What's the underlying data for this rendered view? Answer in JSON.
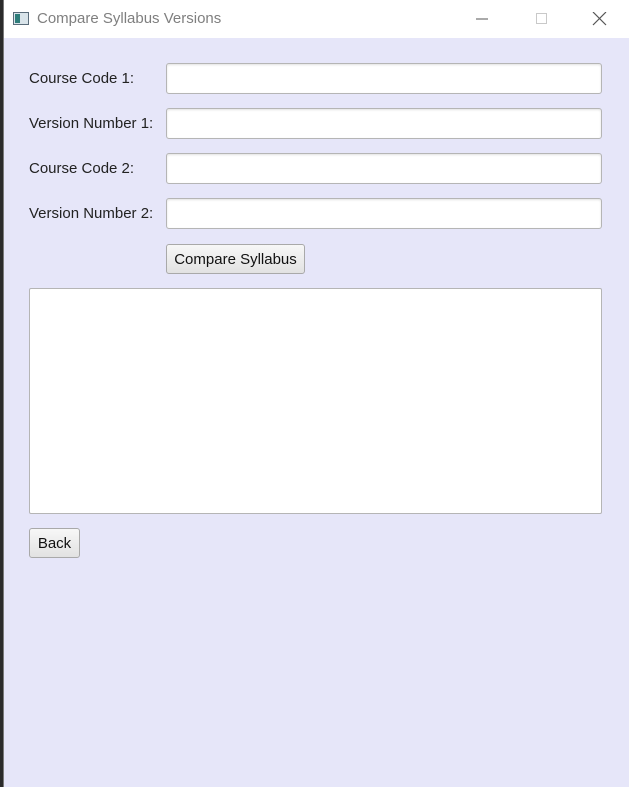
{
  "window": {
    "title": "Compare Syllabus Versions"
  },
  "form": {
    "course_code_1_label": "Course Code 1:",
    "version_number_1_label": "Version Number 1:",
    "course_code_2_label": "Course Code 2:",
    "version_number_2_label": "Version Number 2:",
    "course_code_1_value": "",
    "version_number_1_value": "",
    "course_code_2_value": "",
    "version_number_2_value": "",
    "compare_button_label": "Compare Syllabus",
    "result_text": "",
    "back_button_label": "Back"
  },
  "icons": {
    "app": "app-icon",
    "minimize": "minimize-icon",
    "maximize": "maximize-icon",
    "close": "close-icon"
  }
}
